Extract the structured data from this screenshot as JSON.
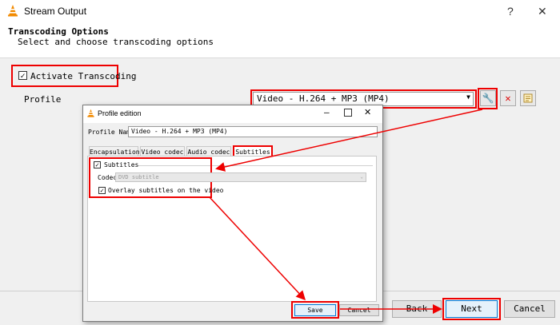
{
  "window": {
    "title": "Stream Output",
    "help_label": "?",
    "close_label": "✕"
  },
  "header": {
    "title": "Transcoding Options",
    "subtitle": "Select and choose transcoding options"
  },
  "activate": {
    "label": "Activate Transcoding",
    "checked": true
  },
  "profile": {
    "label": "Profile",
    "selected": "Video - H.264 + MP3 (MP4)"
  },
  "buttons": {
    "back": "Back",
    "next": "Next",
    "cancel": "Cancel"
  },
  "dialog": {
    "title": "Profile edition",
    "profile_name_label": "Profile Name",
    "profile_name_value": "Video - H.264 + MP3 (MP4)",
    "tabs": [
      "Encapsulation",
      "Video codec",
      "Audio codec",
      "Subtitles"
    ],
    "active_tab": "Subtitles",
    "subtitles_label": "Subtitles",
    "codec_label": "Codec",
    "codec_value": "DVD subtitle",
    "overlay_label": "Overlay subtitles on the video",
    "save_label": "Save",
    "cancel_label": "Cancel"
  },
  "colors": {
    "highlight_red": "#e00000",
    "vlc_orange": "#f28a00"
  }
}
